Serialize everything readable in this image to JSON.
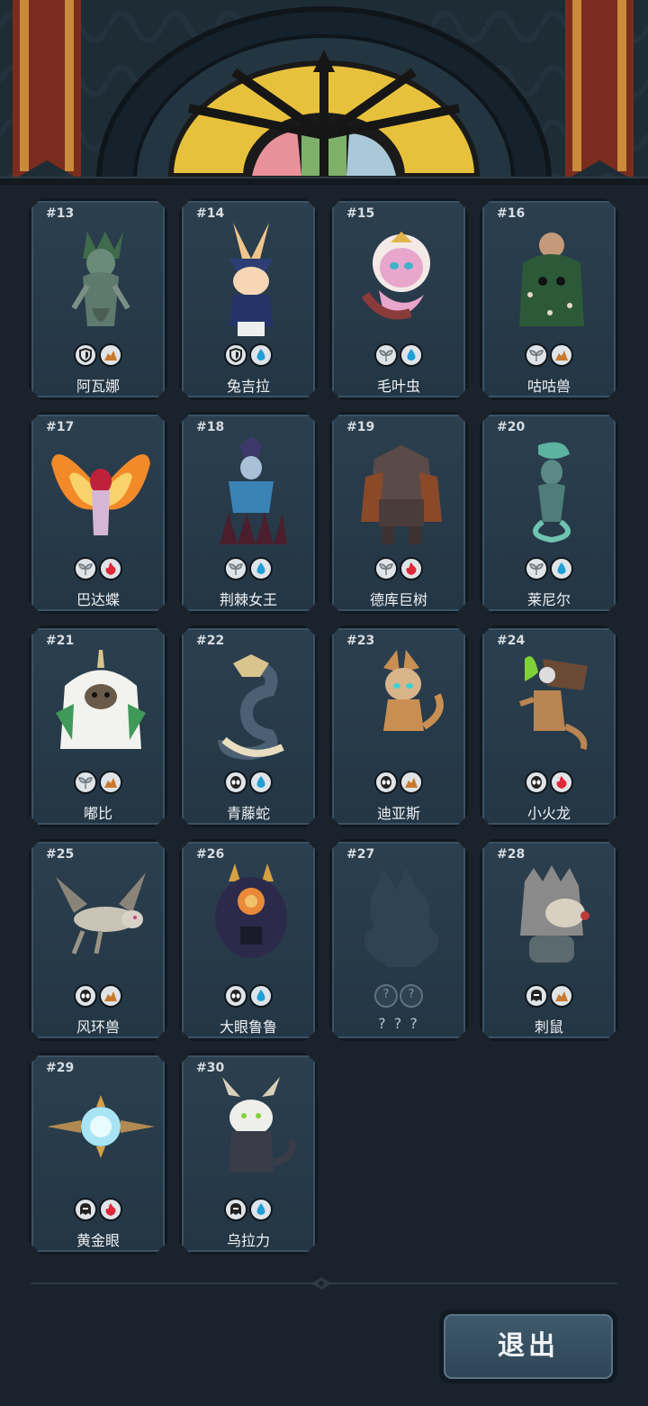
{
  "colors": {
    "background": "#1a232b",
    "card": "#2b3f4f",
    "fire": "#e0283a",
    "water": "#1f9fd6",
    "earth": "#c8792c",
    "plant": "#9aa3a8"
  },
  "cards": [
    {
      "num": "#13",
      "name": "阿瓦娜",
      "badges": [
        "shield-icon",
        "earth-icon"
      ],
      "art": "green-dryad"
    },
    {
      "num": "#14",
      "name": "兔吉拉",
      "badges": [
        "shield-icon",
        "water-icon"
      ],
      "art": "bunny-witch"
    },
    {
      "num": "#15",
      "name": "毛叶虫",
      "badges": [
        "sprout-icon",
        "water-icon"
      ],
      "art": "pink-caterpillar"
    },
    {
      "num": "#16",
      "name": "咕咕兽",
      "badges": [
        "sprout-icon",
        "earth-icon"
      ],
      "art": "moss-golem"
    },
    {
      "num": "#17",
      "name": "巴达蝶",
      "badges": [
        "sprout-icon",
        "fire-icon"
      ],
      "art": "fire-butterfly"
    },
    {
      "num": "#18",
      "name": "荆棘女王",
      "badges": [
        "sprout-icon",
        "water-icon"
      ],
      "art": "thorn-queen"
    },
    {
      "num": "#19",
      "name": "德库巨树",
      "badges": [
        "sprout-icon",
        "fire-icon"
      ],
      "art": "tree-giant"
    },
    {
      "num": "#20",
      "name": "莱尼尔",
      "badges": [
        "sprout-icon",
        "water-icon"
      ],
      "art": "wind-spirit"
    },
    {
      "num": "#21",
      "name": "嘟比",
      "badges": [
        "sprout-icon",
        "earth-icon"
      ],
      "art": "white-yeti"
    },
    {
      "num": "#22",
      "name": "青藤蛇",
      "badges": [
        "alien-icon",
        "water-icon"
      ],
      "art": "vine-serpent"
    },
    {
      "num": "#23",
      "name": "迪亚斯",
      "badges": [
        "alien-icon",
        "earth-icon"
      ],
      "art": "gold-dragonling"
    },
    {
      "num": "#24",
      "name": "小火龙",
      "badges": [
        "alien-icon",
        "fire-icon"
      ],
      "art": "mech-dragon"
    },
    {
      "num": "#25",
      "name": "风环兽",
      "badges": [
        "alien-icon",
        "earth-icon"
      ],
      "art": "wind-beast"
    },
    {
      "num": "#26",
      "name": "大眼鲁鲁",
      "badges": [
        "alien-icon",
        "water-icon"
      ],
      "art": "big-eye-bear"
    },
    {
      "num": "#27",
      "name": "? ? ?",
      "badges": [
        "unknown",
        "unknown"
      ],
      "art": "silhouette",
      "locked": true
    },
    {
      "num": "#28",
      "name": "刺鼠",
      "badges": [
        "helmet-icon",
        "earth-icon"
      ],
      "art": "armored-rat"
    },
    {
      "num": "#29",
      "name": "黄金眼",
      "badges": [
        "helmet-icon",
        "fire-icon"
      ],
      "art": "golden-eye-drone"
    },
    {
      "num": "#30",
      "name": "乌拉力",
      "badges": [
        "helmet-icon",
        "water-icon"
      ],
      "art": "horned-drake"
    }
  ],
  "exit_label": "退出"
}
